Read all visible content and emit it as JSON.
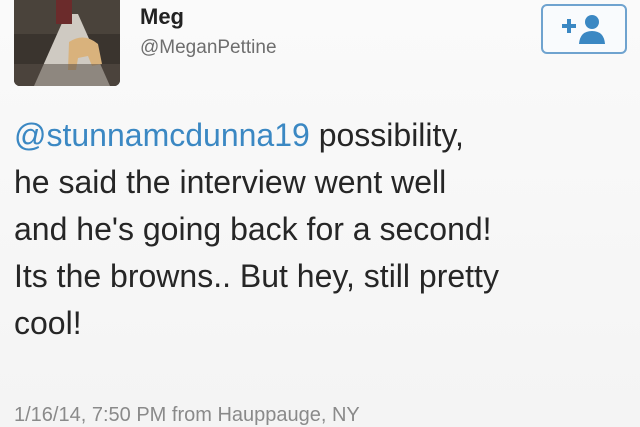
{
  "author": {
    "name": "Meg",
    "handle": "@MeganPettine"
  },
  "follow_button": {
    "icon": "add-user-icon",
    "plus": "+",
    "color": "#3b88c3"
  },
  "tweet": {
    "mention": "@stunnamcdunna19",
    "line1_rest": " possibility,",
    "line2": "he said the interview went well",
    "line3": "and he's going back for a second!",
    "line4": "Its the browns.. But hey, still pretty",
    "line5": "cool!"
  },
  "meta": {
    "timestamp": "1/16/14, 7:50 PM from Hauppauge, NY"
  }
}
